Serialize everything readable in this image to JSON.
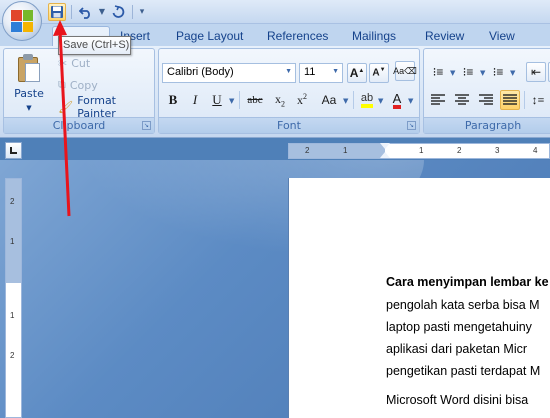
{
  "qat": {
    "tooltip": "Save (Ctrl+S)"
  },
  "tabs": [
    {
      "label": "Insert"
    },
    {
      "label": "Page Layout"
    },
    {
      "label": "References"
    },
    {
      "label": "Mailings"
    },
    {
      "label": "Review"
    },
    {
      "label": "View"
    }
  ],
  "clipboard": {
    "paste_label": "Paste",
    "cut_label": "Cut",
    "copy_label": "Copy",
    "format_painter_label": "Format Painter",
    "group_title": "Clipboard"
  },
  "font": {
    "font_name": "Calibri (Body)",
    "font_size": "11",
    "group_title": "Font"
  },
  "paragraph": {
    "group_title": "Paragraph"
  },
  "ruler": {
    "h_labels": [
      "2",
      "1",
      "1",
      "2",
      "3",
      "4"
    ],
    "v_labels": [
      "2",
      "1",
      "1",
      "2"
    ]
  },
  "document": {
    "lines": [
      "Cara menyimpan lembar ke",
      "pengolah kata serba bisa M",
      "laptop pasti mengetahuiny",
      "aplikasi dari paketan Micr",
      "pengetikan pasti terdapat M",
      "Microsoft Word disini bisa"
    ]
  },
  "colors": {
    "highlight": "#ffff00",
    "font_color": "#e02020",
    "annotation_arrow": "#e8141c"
  }
}
